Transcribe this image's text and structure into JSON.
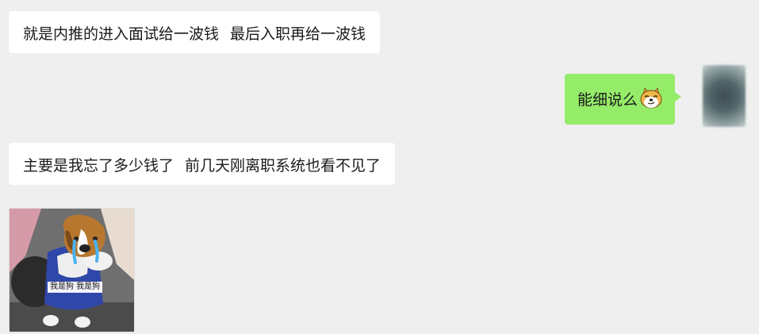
{
  "messages": [
    {
      "side": "in",
      "parts": [
        "就是内推的进入面试给一波钱",
        "最后入职再给一波钱"
      ]
    },
    {
      "side": "out",
      "text": "能细说么"
    },
    {
      "side": "in",
      "parts": [
        "主要是我忘了多少钱了",
        "前几天刚离职系统也看不见了"
      ]
    },
    {
      "side": "in",
      "type": "sticker",
      "caption": "我是狗 我是狗"
    }
  ],
  "colors": {
    "background": "#efefef",
    "incoming_bubble": "#ffffff",
    "outgoing_bubble": "#95ec69"
  },
  "icons": {
    "emoji": "smirking-doge-emoji-icon",
    "avatar": "blurred-avatar"
  }
}
